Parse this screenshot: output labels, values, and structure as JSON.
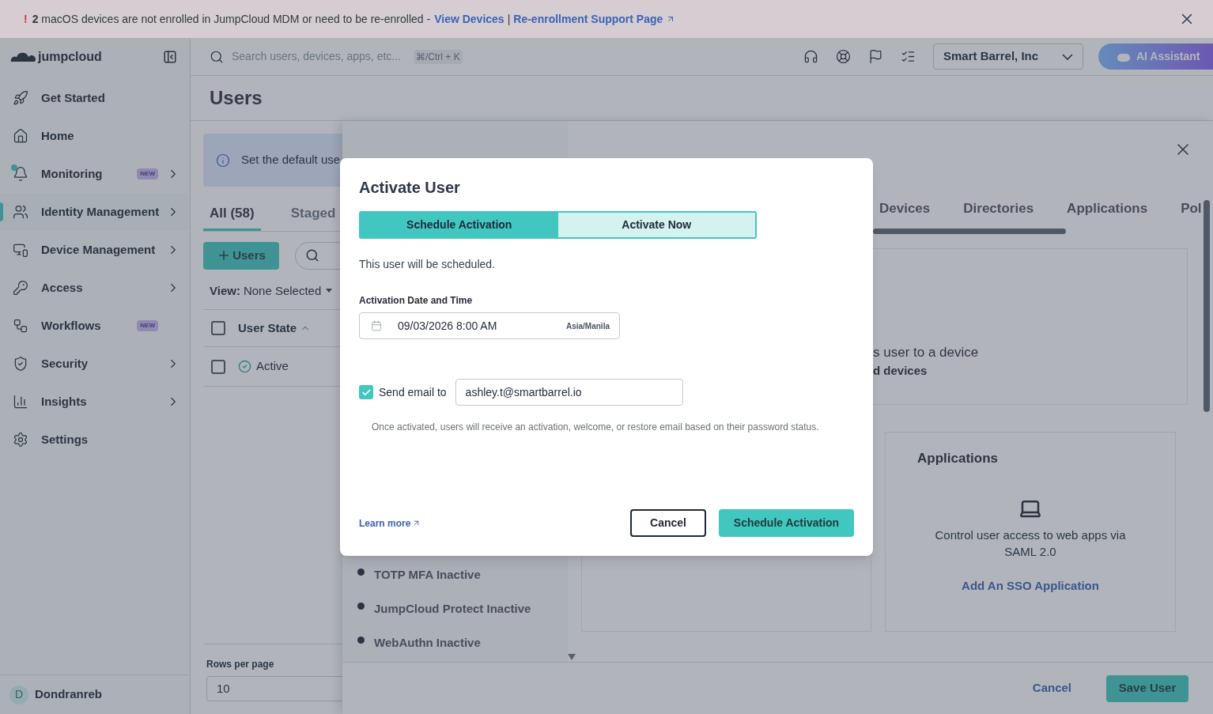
{
  "banner": {
    "mark": "!",
    "count": "2",
    "message": "macOS devices are not enrolled in JumpCloud MDM or need to be re-enrolled -",
    "links": [
      "View Devices",
      "Re-enrollment Support Page"
    ],
    "separator": "|"
  },
  "header": {
    "logo": "jumpcloud",
    "search_placeholder": "Search users, devices, apps, etc...",
    "shortcut": "⌘/Ctrl + K",
    "org": "Smart Barrel, Inc",
    "ai_button": "AI Assistant"
  },
  "sidebar": {
    "items": [
      {
        "label": "Get Started",
        "expandable": false,
        "selected": false,
        "dot": false
      },
      {
        "label": "Home",
        "expandable": false,
        "selected": false,
        "dot": false
      },
      {
        "label": "Monitoring",
        "badge": "NEW",
        "expandable": true,
        "selected": false,
        "dot": true
      },
      {
        "label": "Identity Management",
        "expandable": true,
        "selected": true,
        "dot": false
      },
      {
        "label": "Device Management",
        "expandable": true,
        "selected": false,
        "dot": false
      },
      {
        "label": "Access",
        "expandable": true,
        "selected": false,
        "dot": false
      },
      {
        "label": "Workflows",
        "badge": "NEW",
        "expandable": false,
        "selected": false,
        "dot": false
      },
      {
        "label": "Security",
        "expandable": true,
        "selected": false,
        "dot": false
      },
      {
        "label": "Insights",
        "expandable": true,
        "selected": false,
        "dot": false
      },
      {
        "label": "Settings",
        "expandable": false,
        "selected": false,
        "dot": false
      }
    ],
    "user": {
      "initial": "D",
      "name": "Dondranreb"
    }
  },
  "page": {
    "title": "Users",
    "info": "Set the default use",
    "tabs": [
      {
        "label": "All (58)",
        "selected": true
      },
      {
        "label": "Staged",
        "selected": false
      }
    ],
    "add_button": "Users",
    "view_label": "View:",
    "view_value": "None Selected",
    "select_all_checked": false,
    "columns": [
      "User State"
    ],
    "rows": [
      {
        "state": "Active",
        "checked": false
      }
    ],
    "rows_per_page_label": "Rows per page",
    "rows_per_page": "10"
  },
  "drawer": {
    "tabs": [
      "Devices",
      "Directories",
      "Applications",
      "Pol"
    ],
    "device_card_lines": [
      "s user to a device",
      "d devices"
    ],
    "status_items": [
      "TOTP MFA Inactive",
      "JumpCloud Protect Inactive",
      "WebAuthn Inactive"
    ],
    "apps_card": {
      "title": "Applications",
      "text": "Control user access to web apps via SAML 2.0",
      "link": "Add An SSO Application"
    },
    "footer": {
      "cancel": "Cancel",
      "save": "Save User"
    }
  },
  "modal": {
    "title": "Activate User",
    "modes": [
      {
        "label": "Schedule Activation",
        "selected": true
      },
      {
        "label": "Activate Now",
        "selected": false
      }
    ],
    "description": "This user will be scheduled.",
    "date_label": "Activation Date and Time",
    "date_value": "09/03/2026 8:00 AM",
    "timezone": "Asia/Manila",
    "send_email": {
      "checked": true,
      "label": "Send email to",
      "value": "ashley.t@smartbarrel.io"
    },
    "note": "Once activated, users will receive an activation, welcome, or restore email based on their password status.",
    "learn_more": "Learn more",
    "cancel": "Cancel",
    "confirm": "Schedule Activation"
  }
}
